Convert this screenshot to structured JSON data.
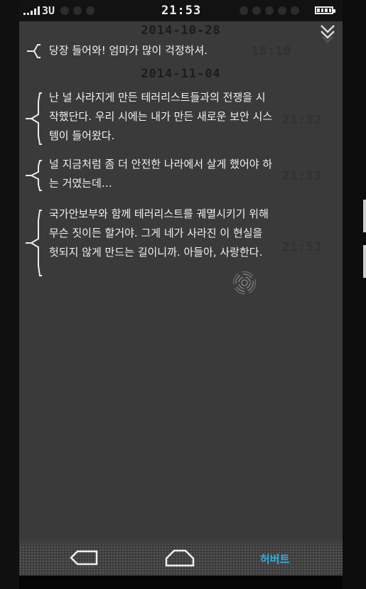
{
  "status_bar": {
    "network": "3U",
    "time": "21:53"
  },
  "conversation": [
    {
      "date": "2014-10-28",
      "messages": [
        {
          "text": "당장 들어와! 엄마가 많이 걱정하셔.",
          "time": "18:10"
        }
      ]
    },
    {
      "date": "2014-11-04",
      "messages": [
        {
          "text": "난 널 사라지게 만든 테러리스트들과의 전쟁을 시작했단다. 우리 시에는 내가 만든 새로운 보안 시스템이 들어왔다.",
          "time": "21:52"
        },
        {
          "text": "널 지금처럼 좀 더 안전한 나라에서 살게 했어야 하는 거였는데…",
          "time": "21:53"
        },
        {
          "text": "국가안보부와 함께 테러리스트를 궤멸시키기 위해 무슨 짓이든 할거야. 그게 네가 사라진 이 현실을 헛되지 않게 만드는 길이니까. 아들아, 사랑한다.",
          "time": "21:53"
        }
      ]
    }
  ],
  "nav_bar": {
    "contact_name": "허버트"
  },
  "colors": {
    "screen_bg": "#3a3a3a",
    "accent": "#2bb3e6",
    "message_text": "#f2f2f2",
    "dim_text": "#1c1c1c"
  },
  "icons": [
    "collapse-chevrons-icon",
    "reply-bracket-icon",
    "fingerprint-icon",
    "back-icon",
    "home-icon",
    "battery-icon",
    "signal-icon"
  ]
}
